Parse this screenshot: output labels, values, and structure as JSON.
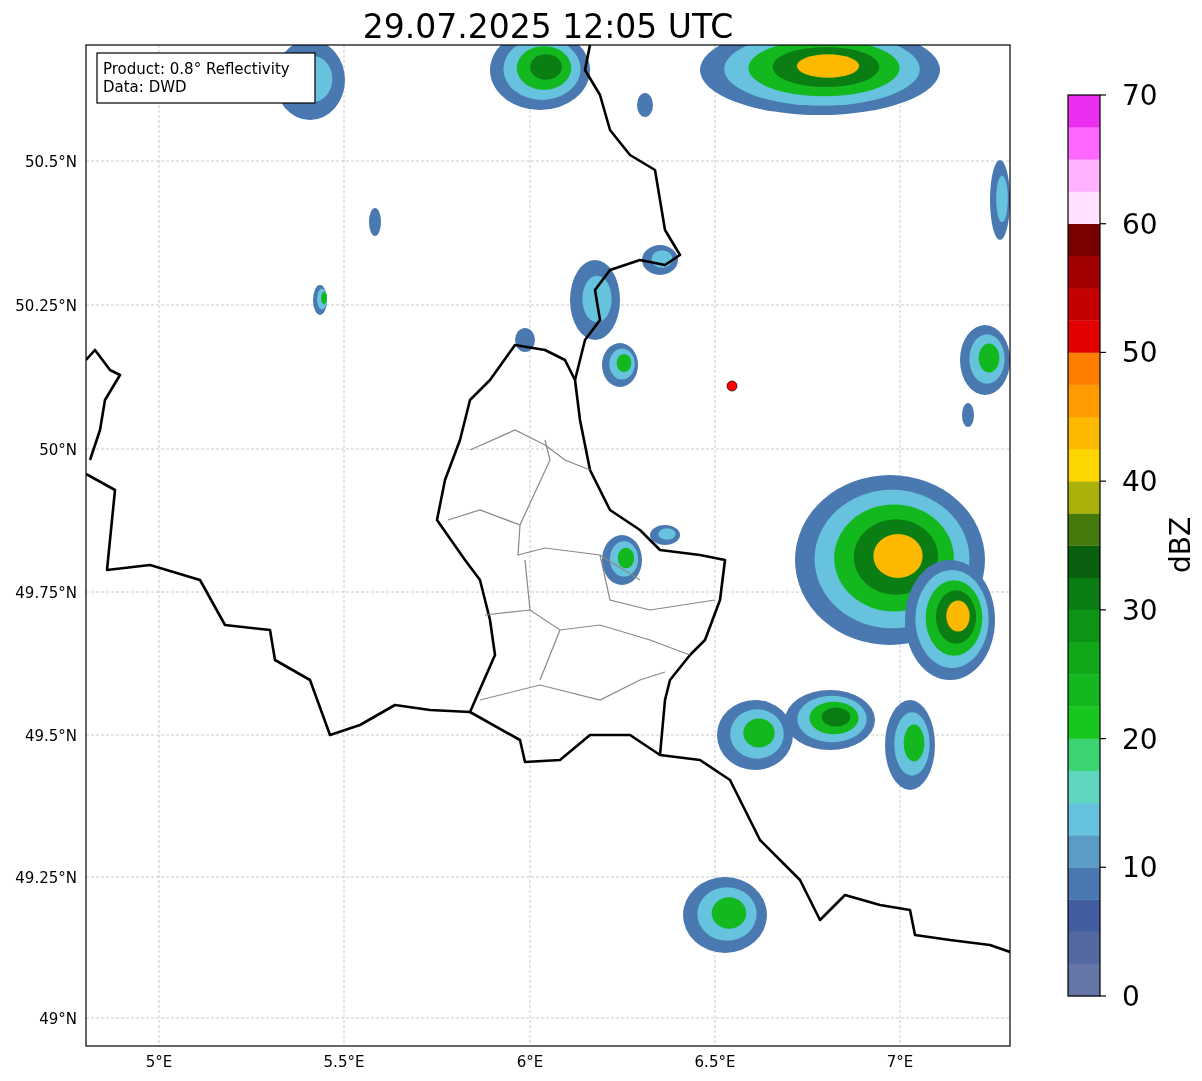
{
  "title": "29.07.2025 12:05 UTC",
  "info_box": [
    "Product: 0.8° Reflectivity",
    "Data: DWD"
  ],
  "map": {
    "xtick_labels": [
      "5°E",
      "5.5°E",
      "6°E",
      "6.5°E",
      "7°E"
    ],
    "ytick_labels": [
      "50.5°N",
      "50.25°N",
      "50°N",
      "49.75°N",
      "49.5°N",
      "49.25°N",
      "49°N"
    ]
  },
  "colorbar": {
    "label": "dBZ",
    "ticks": [
      "70",
      "60",
      "50",
      "40",
      "30",
      "20",
      "10",
      "0"
    ],
    "bands": [
      {
        "color": "#6676a6"
      },
      {
        "color": "#53699f"
      },
      {
        "color": "#435ea0"
      },
      {
        "color": "#4a78b0"
      },
      {
        "color": "#5a9cc5"
      },
      {
        "color": "#66c2dd"
      },
      {
        "color": "#5fd6c0"
      },
      {
        "color": "#3dd571"
      },
      {
        "color": "#16c81e"
      },
      {
        "color": "#12b81d"
      },
      {
        "color": "#10a719"
      },
      {
        "color": "#0d9616"
      },
      {
        "color": "#0b7e13"
      },
      {
        "color": "#09600f"
      },
      {
        "color": "#477a0c"
      },
      {
        "color": "#aab10a"
      },
      {
        "color": "#fdd500"
      },
      {
        "color": "#fdb800"
      },
      {
        "color": "#fd9b00"
      },
      {
        "color": "#fd7e00"
      },
      {
        "color": "#e30000"
      },
      {
        "color": "#c50000"
      },
      {
        "color": "#a10000"
      },
      {
        "color": "#7a0000"
      },
      {
        "color": "#ffe0ff"
      },
      {
        "color": "#ffb3ff"
      },
      {
        "color": "#ff66ff"
      },
      {
        "color": "#ea2ff0"
      }
    ]
  }
}
